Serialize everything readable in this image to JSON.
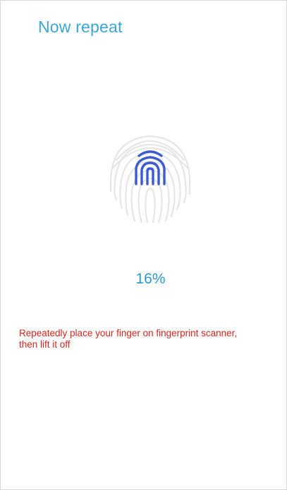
{
  "header": {
    "title": "Now repeat"
  },
  "enrollment": {
    "progress_text": "16%",
    "progress_value": 16,
    "instruction": "Repeatedly place your finger on fingerprint scanner, then lift it off"
  },
  "icons": {
    "fingerprint": "fingerprint-icon"
  },
  "colors": {
    "title": "#3aa6d8",
    "progress": "#2a9bd0",
    "instruction": "#d9241c",
    "fingerprint_active": "#3b5bd6",
    "fingerprint_ghost": "#e3e3e3"
  }
}
